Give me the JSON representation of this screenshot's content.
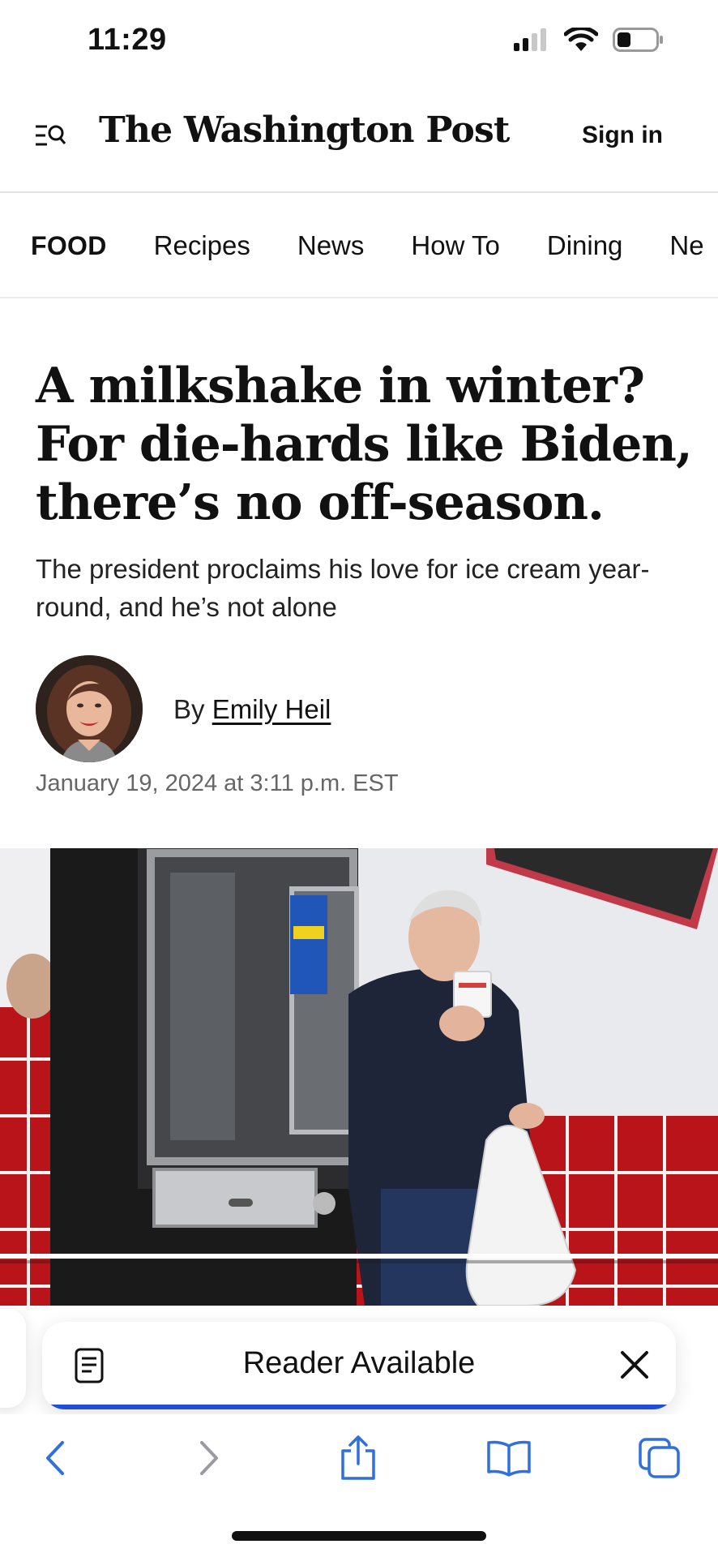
{
  "status_bar": {
    "time": "11:29",
    "icons": [
      "cellular-signal-icon",
      "wifi-icon",
      "battery-icon"
    ]
  },
  "header": {
    "menu_icon": "menu-search-icon",
    "masthead": "The Washington Post",
    "sign_in_label": "Sign in"
  },
  "section_nav": {
    "items": [
      {
        "label": "FOOD",
        "active": true
      },
      {
        "label": "Recipes",
        "active": false
      },
      {
        "label": "News",
        "active": false
      },
      {
        "label": "How To",
        "active": false
      },
      {
        "label": "Dining",
        "active": false
      },
      {
        "label": "Ne",
        "active": false
      }
    ]
  },
  "article": {
    "headline": "A milkshake in winter? For die-hards like Biden, there’s no off-season.",
    "subhead": "The president proclaims his love for ice cream year-round, and he’s not alone",
    "byline_prefix": "By",
    "author": "Emily Heil",
    "date": "January 19, 2024 at 3:11 p.m. EST"
  },
  "reader_banner": {
    "label": "Reader Available",
    "icon": "reader-page-icon",
    "close_icon": "close-icon",
    "progress": 1.0
  },
  "toolbar": {
    "buttons": [
      "back-icon",
      "forward-icon",
      "share-icon",
      "bookmarks-icon",
      "tabs-icon"
    ]
  },
  "colors": {
    "accent": "#1f4fd8",
    "toolbar_icon": "#2f6fde",
    "toolbar_icon_disabled": "#9a9aa0"
  }
}
